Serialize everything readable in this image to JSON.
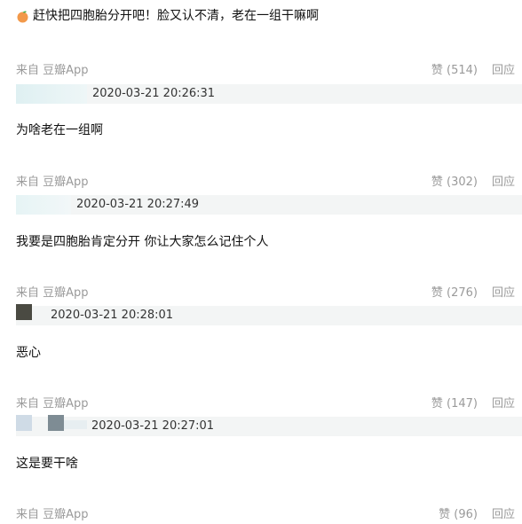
{
  "top_comment": "赶快把四胞胎分开吧！脸又认不清，老在一组干嘛啊",
  "comments": [
    {
      "source": "来自 豆瓣App",
      "likes": "赞 (514)",
      "reply": "回应",
      "timestamp": "2020-03-21 20:26:31",
      "text": "为啥老在一组啊"
    },
    {
      "source": "来自 豆瓣App",
      "likes": "赞 (302)",
      "reply": "回应",
      "timestamp": "2020-03-21 20:27:49",
      "text": "我要是四胞胎肯定分开 你让大家怎么记住个人"
    },
    {
      "source": "来自 豆瓣App",
      "likes": "赞 (276)",
      "reply": "回应",
      "timestamp": "2020-03-21 20:28:01",
      "text": "恶心"
    },
    {
      "source": "来自 豆瓣App",
      "likes": "赞 (147)",
      "reply": "回应",
      "timestamp": "2020-03-21 20:27:01",
      "text": "这是要干啥"
    },
    {
      "source": "来自 豆瓣App",
      "likes": "赞 (96)",
      "reply": "回应"
    }
  ]
}
